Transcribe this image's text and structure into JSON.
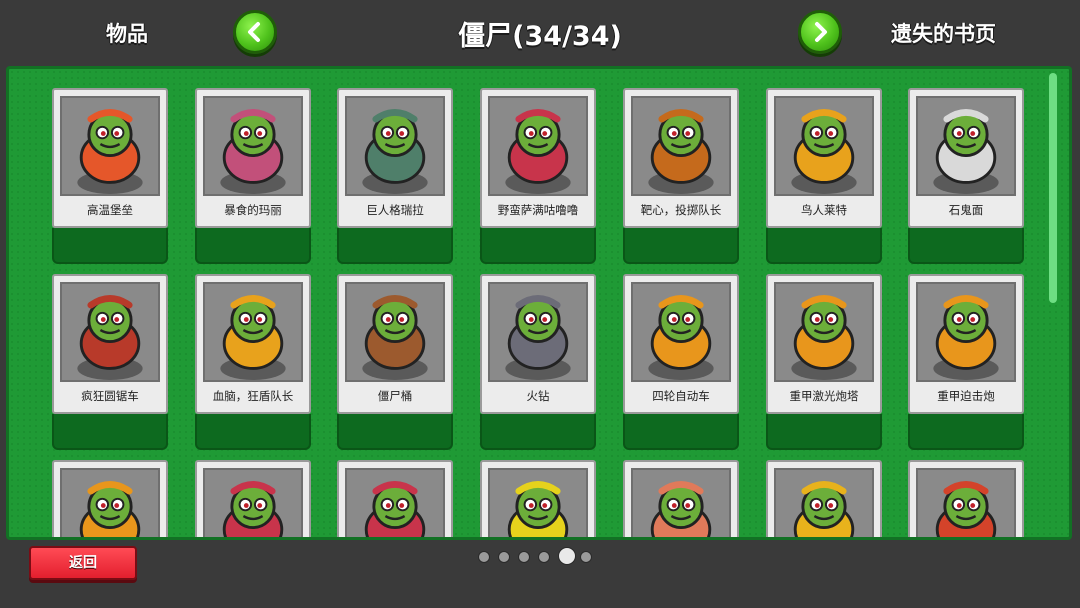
{
  "header": {
    "left_label": "物品",
    "title": "僵尸(34/34)",
    "right_label": "遗失的书页"
  },
  "cards": [
    {
      "name": "高温堡垒",
      "color": "#e5572a"
    },
    {
      "name": "暴食的玛丽",
      "color": "#c2507a"
    },
    {
      "name": "巨人格瑞拉",
      "color": "#4f7f6a"
    },
    {
      "name": "野蛮萨满咕噜噜",
      "color": "#c8344b"
    },
    {
      "name": "靶心，投掷队长",
      "color": "#c56a1c"
    },
    {
      "name": "鸟人莱特",
      "color": "#e8a21c"
    },
    {
      "name": "石鬼面",
      "color": "#d9d9d9"
    },
    {
      "name": "疯狂圆锯车",
      "color": "#b83a2a"
    },
    {
      "name": "血脑，狂盾队长",
      "color": "#e8a21c"
    },
    {
      "name": "僵尸桶",
      "color": "#9c5a2e"
    },
    {
      "name": "火钻",
      "color": "#6c6c78"
    },
    {
      "name": "四轮自动车",
      "color": "#e8961c"
    },
    {
      "name": "重甲激光炮塔",
      "color": "#e8961c"
    },
    {
      "name": "重甲迫击炮",
      "color": "#e8961c"
    },
    {
      "name": "",
      "color": "#e8961c"
    },
    {
      "name": "",
      "color": "#c8344b"
    },
    {
      "name": "",
      "color": "#c8344b"
    },
    {
      "name": "",
      "color": "#e6d21c"
    },
    {
      "name": "",
      "color": "#e07a5a"
    },
    {
      "name": "",
      "color": "#e8b21c"
    },
    {
      "name": "",
      "color": "#d4432a"
    }
  ],
  "pagination": {
    "total": 6,
    "current": 5
  },
  "back_label": "返回"
}
